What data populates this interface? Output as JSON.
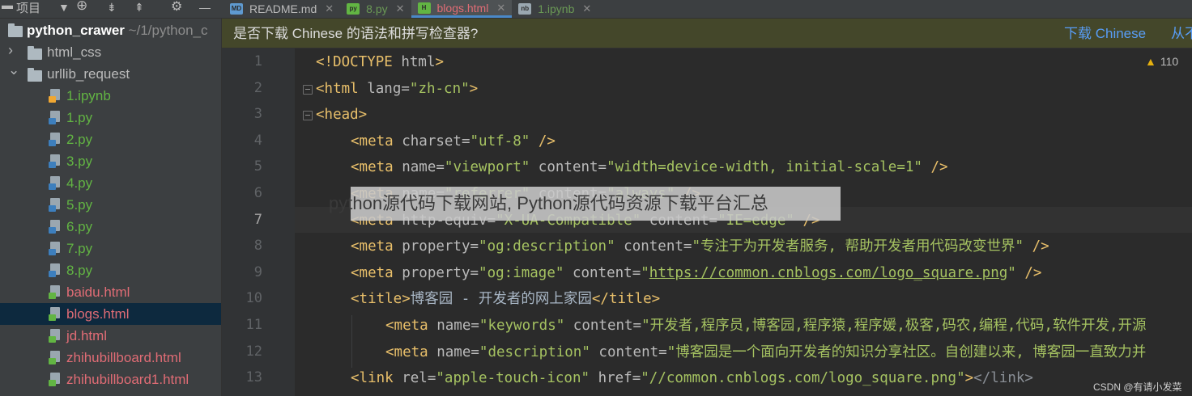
{
  "colors": {
    "accent": "#4a88c7",
    "html_file": "#e06c75",
    "py_file": "#62b543",
    "selection": "#0d293e",
    "link": "#589df6"
  },
  "toolbar": {
    "project_label": "项目",
    "icons": [
      "chevron-down-icon",
      "target-icon",
      "collapse-all-icon",
      "expand-all-icon",
      "gear-icon",
      "minimize-icon"
    ]
  },
  "tabs": [
    {
      "label": "README.md",
      "icon": "markdown-file-icon",
      "active": false
    },
    {
      "label": "8.py",
      "icon": "python-file-icon",
      "active": false
    },
    {
      "label": "blogs.html",
      "icon": "html-file-icon",
      "active": true
    },
    {
      "label": "1.ipynb",
      "icon": "notebook-file-icon",
      "active": false
    }
  ],
  "project": {
    "root": {
      "name": "python_crawer",
      "path": "~/1/python_c"
    },
    "items": [
      {
        "label": "html_css",
        "type": "folder",
        "expanded": false
      },
      {
        "label": "urllib_request",
        "type": "folder",
        "expanded": true
      },
      {
        "label": "1.ipynb",
        "type": "ipynb"
      },
      {
        "label": "1.py",
        "type": "py"
      },
      {
        "label": "2.py",
        "type": "py"
      },
      {
        "label": "3.py",
        "type": "py"
      },
      {
        "label": "4.py",
        "type": "py"
      },
      {
        "label": "5.py",
        "type": "py"
      },
      {
        "label": "6.py",
        "type": "py"
      },
      {
        "label": "7.py",
        "type": "py"
      },
      {
        "label": "8.py",
        "type": "py"
      },
      {
        "label": "baidu.html",
        "type": "html"
      },
      {
        "label": "blogs.html",
        "type": "html",
        "selected": true
      },
      {
        "label": "jd.html",
        "type": "html"
      },
      {
        "label": "zhihubillboard.html",
        "type": "html"
      },
      {
        "label": "zhihubillboard1.html",
        "type": "html"
      }
    ]
  },
  "notice": {
    "message": "是否下载 Chinese 的语法和拼写检查器?",
    "download_label": "下载 Chinese",
    "never_label": "从不"
  },
  "editor": {
    "warning_count": "110",
    "current_line": "7",
    "line_numbers": [
      "1",
      "2",
      "3",
      "4",
      "5",
      "6",
      "7",
      "8",
      "9",
      "10",
      "11",
      "12",
      "13"
    ],
    "lines": [
      [
        [
          "tg",
          "<!DOCTYPE "
        ],
        [
          "at",
          "html"
        ],
        [
          "tg",
          ">"
        ]
      ],
      [
        [
          "tg",
          "<html "
        ],
        [
          "at",
          "lang="
        ],
        [
          "vl",
          "\"zh-cn\""
        ],
        [
          "tg",
          ">"
        ]
      ],
      [
        [
          "tg",
          "<head>"
        ]
      ],
      [
        [
          "tg",
          "<meta "
        ],
        [
          "at",
          "charset="
        ],
        [
          "vl",
          "\"utf-8\""
        ],
        [
          "tg",
          " />"
        ]
      ],
      [
        [
          "tg",
          "<meta "
        ],
        [
          "at",
          "name="
        ],
        [
          "vl",
          "\"viewport\""
        ],
        [
          "at",
          " content="
        ],
        [
          "vl",
          "\"width=device-width, initial-scale=1\""
        ],
        [
          "tg",
          " />"
        ]
      ],
      [
        [
          "tg",
          "<meta "
        ],
        [
          "at",
          "name="
        ],
        [
          "vl",
          "\"referrer\""
        ],
        [
          "at",
          " content="
        ],
        [
          "vl",
          "\"always\""
        ],
        [
          "tg",
          " />"
        ]
      ],
      [
        [
          "tg",
          "<meta "
        ],
        [
          "at",
          "http-equiv="
        ],
        [
          "vl",
          "\"X-UA-Compatible\""
        ],
        [
          "at",
          " content="
        ],
        [
          "vl",
          "\"IE=edge\""
        ],
        [
          "tg",
          " />"
        ]
      ],
      [
        [
          "tg",
          "<meta "
        ],
        [
          "at",
          "property="
        ],
        [
          "vl",
          "\"og:description\""
        ],
        [
          "at",
          " content="
        ],
        [
          "vl",
          "\"专注于为开发者服务, 帮助开发者用代码改变世界\""
        ],
        [
          "tg",
          " />"
        ]
      ],
      [
        [
          "tg",
          "<meta "
        ],
        [
          "at",
          "property="
        ],
        [
          "vl",
          "\"og:image\""
        ],
        [
          "at",
          " content="
        ],
        [
          "vl",
          "\""
        ],
        [
          "ur",
          "https://common.cnblogs.com/logo_square.png"
        ],
        [
          "vl",
          "\""
        ],
        [
          "tg",
          " />"
        ]
      ],
      [
        [
          "tg",
          "<title>"
        ],
        [
          "tx",
          "博客园 - 开发者的网上家园"
        ],
        [
          "tg",
          "</title>"
        ]
      ],
      [
        [
          "tg",
          "<meta "
        ],
        [
          "at",
          "name="
        ],
        [
          "vl",
          "\"keywords\""
        ],
        [
          "at",
          " content="
        ],
        [
          "vl",
          "\"开发者,程序员,博客园,程序猿,程序媛,极客,码农,编程,代码,软件开发,开源"
        ]
      ],
      [
        [
          "tg",
          "<meta "
        ],
        [
          "at",
          "name="
        ],
        [
          "vl",
          "\"description\""
        ],
        [
          "at",
          " content="
        ],
        [
          "vl",
          "\"博客园是一个面向开发者的知识分享社区。自创建以来, 博客园一直致力并"
        ]
      ],
      [
        [
          "tg",
          "<link "
        ],
        [
          "at",
          "rel="
        ],
        [
          "vl",
          "\"apple-touch-icon\""
        ],
        [
          "at",
          " href="
        ],
        [
          "vl",
          "\"//common.cnblogs.com/logo_square.png\""
        ],
        [
          "tg",
          ">"
        ],
        [
          "dtx",
          "</link>"
        ]
      ]
    ]
  },
  "overlay": {
    "text": "python源代码下载网站, Python源代码资源下载平台汇总"
  },
  "credit": "CSDN @有请小发菜"
}
